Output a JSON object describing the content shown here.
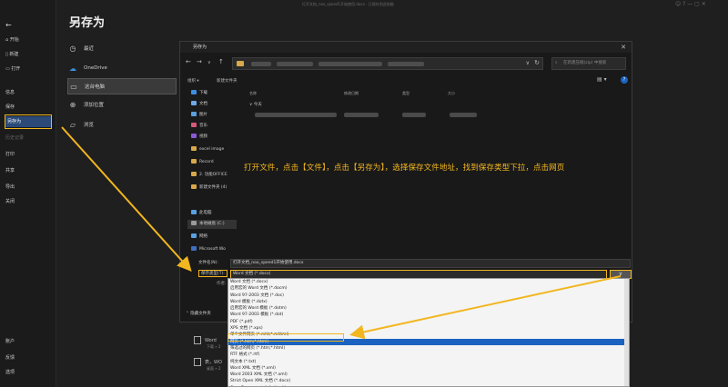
{
  "window_title": "打开文档_noo_speed1开始使用.docx · 已保存到此电脑",
  "page_title": "另存为",
  "nav": {
    "back": "←",
    "items": [
      {
        "label": "开始",
        "icon": "home-icon"
      },
      {
        "label": "新建",
        "icon": "new-doc-icon"
      },
      {
        "label": "打开",
        "icon": "folder-open-icon"
      },
      {
        "label": "信息"
      },
      {
        "label": "保存"
      },
      {
        "label": "另存为"
      },
      {
        "label": "历史记录"
      },
      {
        "label": "打印"
      },
      {
        "label": "共享"
      },
      {
        "label": "导出"
      },
      {
        "label": "关闭"
      }
    ],
    "bottom": [
      {
        "label": "账户"
      },
      {
        "label": "反馈"
      },
      {
        "label": "选项"
      }
    ]
  },
  "locations": [
    {
      "label": "最近",
      "icon": "clock-icon"
    },
    {
      "label": "OneDrive",
      "icon": "cloud-icon"
    },
    {
      "label": "这台电脑",
      "icon": "pc-icon"
    },
    {
      "label": "添加位置",
      "icon": "globe-icon"
    },
    {
      "label": "浏览",
      "icon": "folder-icon"
    }
  ],
  "dialog": {
    "title": "另存为",
    "search_placeholder": "在新建压缩(zip) 中搜索",
    "organize": "组织 ▾",
    "new_folder": "新建文件夹",
    "columns": [
      "名称",
      "修改日期",
      "类型",
      "大小"
    ],
    "today": "今天",
    "sidebar": [
      {
        "label": "下载",
        "color": "#3e8ee0"
      },
      {
        "label": "文档",
        "color": "#6ea8e6"
      },
      {
        "label": "图片",
        "color": "#5aa0e0"
      },
      {
        "label": "音乐",
        "color": "#d35a7a"
      },
      {
        "label": "视频",
        "color": "#8a5ad3"
      },
      {
        "label": "excel image",
        "color": "#d8a94a"
      },
      {
        "label": "Record",
        "color": "#d8a94a"
      },
      {
        "label": "2. 功能OFFICE",
        "color": "#d8a94a"
      },
      {
        "label": "新建文件夹 (4)",
        "color": "#d8a94a"
      },
      {
        "label": "此电脑",
        "color": "#5aa0e0"
      },
      {
        "label": "本地磁盘 (C:)",
        "color": "#9a9a9a"
      },
      {
        "label": "网络",
        "color": "#5aa0e0"
      },
      {
        "label": "Microsoft Wo",
        "color": "#3e6fc0"
      }
    ],
    "filename_label": "文件名(N):",
    "filename_value": "打开文档_noo_speed1开始使用.docx",
    "filetype_label": "保存类型(T):",
    "filetype_value": "Word 文档 (*.docx)",
    "author_label": "作者:",
    "hide_folders": "⌃ 隐藏文件夹"
  },
  "annotation": "打开文件，点击【文件】，点击【另存为】，选择保存文件地址，找到保存类型下拉，点击网页",
  "dropdown_options": [
    "Word 文档 (*.docx)",
    "启用宏的 Word 文档 (*.docm)",
    "Word 97-2003 文档 (*.doc)",
    "Word 模板 (*.dotx)",
    "启用宏的 Word 模板 (*.dotm)",
    "Word 97-2003 模板 (*.dot)",
    "PDF (*.pdf)",
    "XPS 文档 (*.xps)",
    "单个文件网页 (*.mht;*.mhtml)",
    "网页 (*.htm;*.html)",
    "筛选过的网页 (*.htm;*.html)",
    "RTF 格式 (*.rtf)",
    "纯文本 (*.txt)",
    "Word XML 文档 (*.xml)",
    "Word 2003 XML 文档 (*.xml)",
    "Strict Open XML 文档 (*.docx)",
    "OpenDocument 文本 (*.odt)"
  ],
  "dropdown_selected_index": 9,
  "bg_docs": [
    {
      "title": "Word",
      "sub": "下载 » 2"
    },
    {
      "title": "表，WO",
      "sub": "桌面 » 2"
    }
  ],
  "colors": {
    "accent": "#f2b61f",
    "selection": "#1a63c0",
    "nav_active": "#2b4a78"
  }
}
